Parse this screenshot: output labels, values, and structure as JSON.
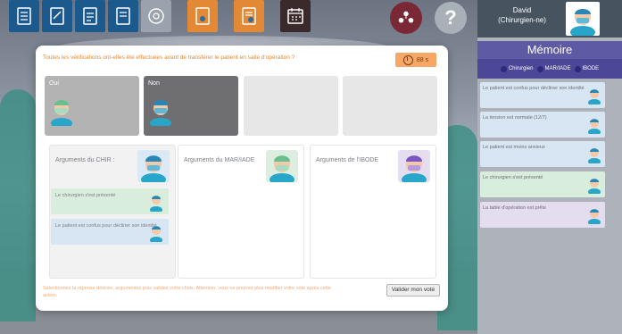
{
  "colors": {
    "accent_orange": "#e8892f",
    "memory_header": "#5e5aa3",
    "legend_bar": "#4c4898",
    "toolbar_blue": "#1c5a8d",
    "toolbar_orange": "#e38834"
  },
  "toolbar": {
    "icons": [
      "checklist-icon",
      "document-edit-icon",
      "document-icon",
      "settings-sphere-icon",
      "patient-file-icon",
      "patient-file-2-icon",
      "calendar-icon"
    ],
    "team_icon": "team-icon",
    "help_label": "?"
  },
  "user": {
    "name": "David",
    "role": "(Chirurgien-ne)"
  },
  "memory": {
    "title": "Mémoire",
    "legend": [
      "Chirurgien",
      "MAR/IADE",
      "IBODE"
    ],
    "cards": [
      {
        "text": "Le patient est confus pour décliner son identité",
        "role": "chirurgien"
      },
      {
        "text": "La tension est normale (12/7)",
        "role": "chirurgien"
      },
      {
        "text": "Le patient est moins anxieux",
        "role": "chirurgien"
      },
      {
        "text": "Le chirurgien s'est présenté",
        "role": "mar"
      },
      {
        "text": "La table d'opération est prête",
        "role": "ibode"
      }
    ]
  },
  "question": {
    "text": "Toutes les vérifications ont-elles été effectuées avant de transférer le patient en salle d'opération ?",
    "timer": "88 s",
    "answers": [
      {
        "label": "Oui",
        "tag": "MAR/IADE"
      },
      {
        "label": "Non",
        "tag": "CHIR"
      }
    ]
  },
  "arguments": {
    "chir_title": "Arguments du CHIR :",
    "mar_title": "Arguments du MAR/IADE",
    "ibode_title": "Arguments de l'IBODE",
    "chir_cards": [
      {
        "text": "Le chirurgien s'est présenté",
        "role": "mar"
      },
      {
        "text": "Le patient est confus pour décliner son identité",
        "role": "chirurgien"
      }
    ]
  },
  "footer": {
    "hint": "Sélectionnez la réponse désirée, argumentez puis validez votre choix. Attention, vous ne pourrez plus modifier votre vote après cette action.",
    "validate_label": "Valider mon vote"
  }
}
